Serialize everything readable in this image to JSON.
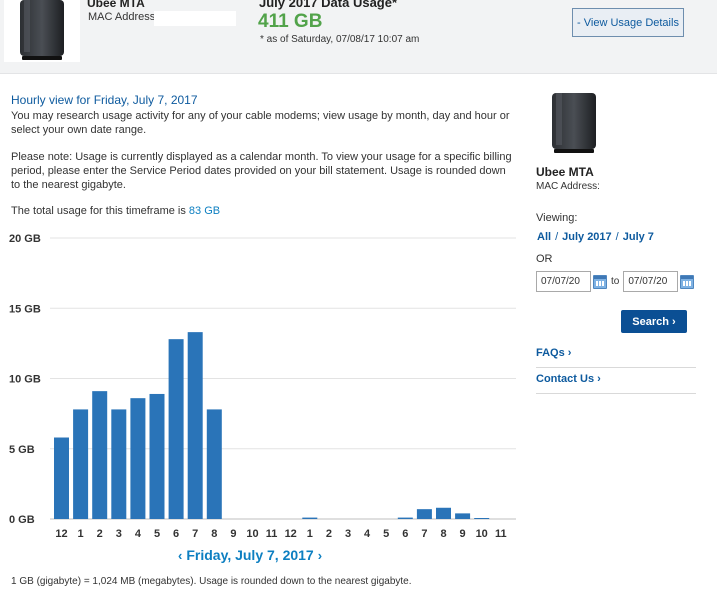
{
  "header": {
    "modem_name": "Ubee MTA",
    "mac_label": "MAC Address:",
    "usage_title": "July 2017 Data Usage*",
    "usage_total": "411 GB",
    "as_of": "* as of Saturday, 07/08/17 10:07 am",
    "details_button": "- View Usage Details"
  },
  "main": {
    "hourly_title": "Hourly view for Friday, July 7, 2017",
    "intro": "You may research usage activity for any of your cable modems; view usage by month, day and hour or select your own date range.",
    "note": "Please note: Usage is currently displayed as a calendar month. To view your usage for a specific billing period, please enter the Service Period dates provided on your bill statement. Usage is rounded down to the nearest gigabyte.",
    "total_prefix": "The total usage for this timeframe is",
    "total_value": "83 GB",
    "day_label": "Friday, July 7, 2017",
    "prev_glyph": "‹",
    "next_glyph": "›",
    "footnote": "1 GB (gigabyte) = 1,024 MB (megabytes). Usage is rounded down to the nearest gigabyte."
  },
  "chart_data": {
    "type": "bar",
    "categories": [
      "12",
      "1",
      "2",
      "3",
      "4",
      "5",
      "6",
      "7",
      "8",
      "9",
      "10",
      "11",
      "12",
      "1",
      "2",
      "3",
      "4",
      "5",
      "6",
      "7",
      "8",
      "9",
      "10",
      "11"
    ],
    "values": [
      5.8,
      7.8,
      9.1,
      7.8,
      8.6,
      8.9,
      12.8,
      13.3,
      7.8,
      0,
      0,
      0,
      0,
      0.1,
      0,
      0,
      0,
      0,
      0.1,
      0.7,
      0.8,
      0.4,
      0.05,
      0
    ],
    "yticks": [
      "0 GB",
      "5 GB",
      "10 GB",
      "15 GB",
      "20 GB"
    ],
    "ylim": [
      0,
      20
    ],
    "bar_color": "#2a74b8",
    "grid": true
  },
  "sidebar": {
    "modem_name": "Ubee MTA",
    "mac_label": "MAC Address:",
    "viewing_label": "Viewing:",
    "crumbs": [
      "All",
      "July 2017",
      "July 7"
    ],
    "crumb_sep": "/",
    "or_label": "OR",
    "from_date": "07/07/20",
    "to_label": "to",
    "to_date": "07/07/20",
    "search_button": "Search ›",
    "faqs_link": "FAQs ›",
    "contact_link": "Contact Us ›"
  },
  "colors": {
    "accent": "#0d5a9e",
    "link": "#0d7fc1",
    "usage_green": "#52a34a",
    "bar": "#2a74b8"
  }
}
